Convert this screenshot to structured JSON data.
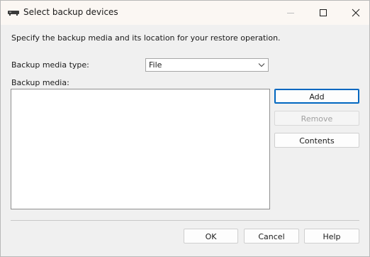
{
  "window": {
    "title": "Select backup devices"
  },
  "icons": {
    "app": "backup-device-icon",
    "minimize": "minimize-icon",
    "maximize": "maximize-icon",
    "close": "close-icon",
    "dropdown": "chevron-down-icon"
  },
  "dialog": {
    "instructions": "Specify the backup media and its location for your restore operation.",
    "media_type_label": "Backup media type:",
    "media_type_value": "File",
    "media_label": "Backup media:",
    "media_items": []
  },
  "buttons": {
    "add": "Add",
    "remove": "Remove",
    "contents": "Contents",
    "ok": "OK",
    "cancel": "Cancel",
    "help": "Help"
  },
  "colors": {
    "accent": "#0067c0",
    "titlebar": "#fbf7f3",
    "dialog_background": "#f0f0f0"
  }
}
